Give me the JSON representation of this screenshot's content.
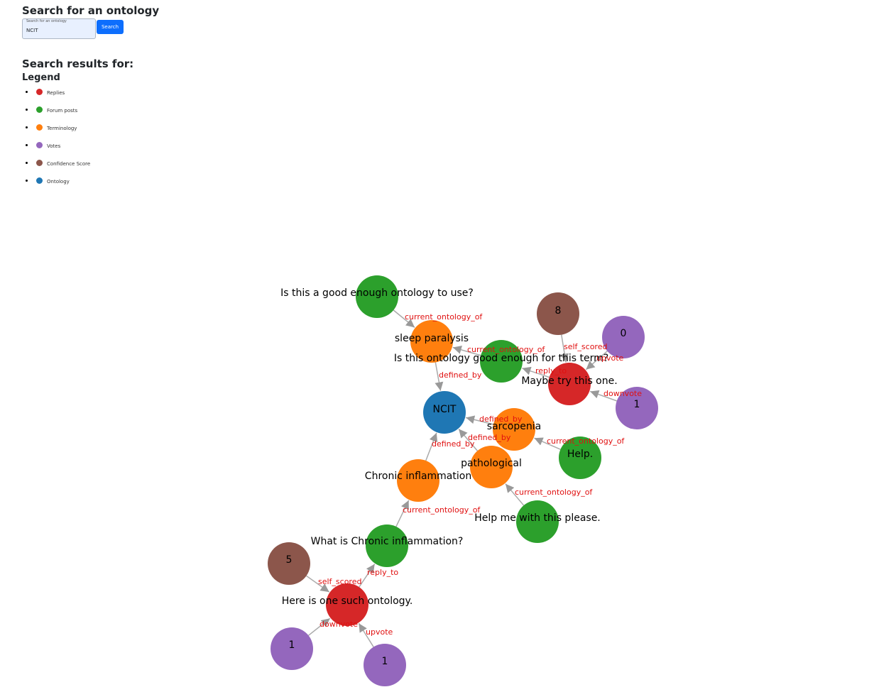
{
  "search": {
    "heading": "Search for an ontology",
    "float_label": "Search for an ontology",
    "value": "NCIT",
    "button_label": "Search"
  },
  "results": {
    "heading": "Search results for:"
  },
  "legend": {
    "heading": "Legend",
    "items": [
      {
        "label": "Replies",
        "color": "#d62728"
      },
      {
        "label": "Forum posts",
        "color": "#2ca02c"
      },
      {
        "label": "Terminology",
        "color": "#ff7f0e"
      },
      {
        "label": "Votes",
        "color": "#9467bd"
      },
      {
        "label": "Confidence Score",
        "color": "#8c564b"
      },
      {
        "label": "Ontology",
        "color": "#1f77b4"
      }
    ]
  },
  "graph": {
    "nodes": [
      {
        "id": "ncit",
        "type": "Ontology",
        "label": "NCIT"
      },
      {
        "id": "sleep",
        "type": "Terminology",
        "label": "sleep paralysis"
      },
      {
        "id": "sarco",
        "type": "Terminology",
        "label": "sarcopenia"
      },
      {
        "id": "patho",
        "type": "Terminology",
        "label": "pathological"
      },
      {
        "id": "chronic",
        "type": "Terminology",
        "label": "Chronic inflammation"
      },
      {
        "id": "post1",
        "type": "Forum posts",
        "label": "Is this a good enough ontology to use?"
      },
      {
        "id": "post2",
        "type": "Forum posts",
        "label": "Is this ontology good enough for this term?"
      },
      {
        "id": "post3",
        "type": "Forum posts",
        "label": "Help."
      },
      {
        "id": "post4",
        "type": "Forum posts",
        "label": "Help me with this please."
      },
      {
        "id": "post5",
        "type": "Forum posts",
        "label": "What is Chronic inflammation?"
      },
      {
        "id": "reply1",
        "type": "Replies",
        "label": "Maybe try this one."
      },
      {
        "id": "reply2",
        "type": "Replies",
        "label": "Here is one such ontology."
      },
      {
        "id": "score8",
        "type": "Confidence Score",
        "label": "8"
      },
      {
        "id": "score5",
        "type": "Confidence Score",
        "label": "5"
      },
      {
        "id": "vote0",
        "type": "Votes",
        "label": "0"
      },
      {
        "id": "vote1a",
        "type": "Votes",
        "label": "1"
      },
      {
        "id": "vote1b",
        "type": "Votes",
        "label": "1"
      },
      {
        "id": "vote1c",
        "type": "Votes",
        "label": "1"
      }
    ],
    "edges": [
      {
        "source": "post1",
        "target": "sleep",
        "label": "current_ontology_of"
      },
      {
        "source": "sleep",
        "target": "ncit",
        "label": "defined_by"
      },
      {
        "source": "post2",
        "target": "sleep",
        "label": "current_ontology_of"
      },
      {
        "source": "reply1",
        "target": "post2",
        "label": "reply_to"
      },
      {
        "source": "score8",
        "target": "reply1",
        "label": "self_scored"
      },
      {
        "source": "vote0",
        "target": "reply1",
        "label": "upvote"
      },
      {
        "source": "vote1a",
        "target": "reply1",
        "label": "downvote"
      },
      {
        "source": "sarco",
        "target": "ncit",
        "label": "defined_by"
      },
      {
        "source": "post3",
        "target": "sarco",
        "label": "current_ontology_of"
      },
      {
        "source": "patho",
        "target": "ncit",
        "label": "defined_by"
      },
      {
        "source": "post4",
        "target": "patho",
        "label": "current_ontology_of"
      },
      {
        "source": "chronic",
        "target": "ncit",
        "label": "defined_by"
      },
      {
        "source": "post5",
        "target": "chronic",
        "label": "current_ontology_of"
      },
      {
        "source": "reply2",
        "target": "post5",
        "label": "reply_to"
      },
      {
        "source": "score5",
        "target": "reply2",
        "label": "self_scored"
      },
      {
        "source": "vote1b",
        "target": "reply2",
        "label": "downvote"
      },
      {
        "source": "vote1c",
        "target": "reply2",
        "label": "upvote"
      }
    ]
  }
}
